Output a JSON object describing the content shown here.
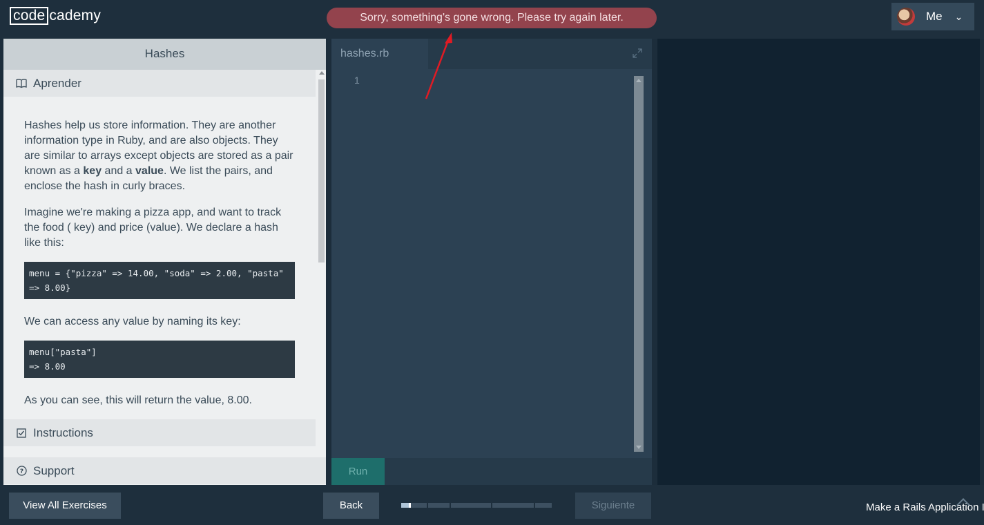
{
  "header": {
    "logo_boxed": "code",
    "logo_rest": "cademy",
    "error_message": "Sorry, something's gone wrong. Please try again later.",
    "user_label": "Me"
  },
  "lesson": {
    "title": "Hashes",
    "learn_label": "Aprender",
    "paragraph1_parts": [
      "Hashes help us store information. They are another information type in Ruby, and are also objects. They are similar to arrays except objects are stored as a pair known as a ",
      "key",
      " and a ",
      "value",
      ". We list the pairs, and enclose the hash in curly braces."
    ],
    "paragraph2": "Imagine we're making a pizza app, and want to track the food ( key) and price (value). We declare a hash like this:",
    "code1": "menu = {\"pizza\" => 14.00, \"soda\" => 2.00, \"pasta\" => 8.00}",
    "paragraph3": "We can access any value by naming its key:",
    "code2_line1": "menu[\"pasta\"]",
    "code2_line2": "=> 8.00",
    "paragraph4": "As you can see, this will return the value, 8.00.",
    "instructions_label": "Instructions",
    "support_label": "Support"
  },
  "editor": {
    "filename": "hashes.rb",
    "line_number": "1",
    "run_label": "Run"
  },
  "footer": {
    "view_all_label": "View All Exercises",
    "back_label": "Back",
    "next_label": "Siguiente",
    "project_label": "Make a Rails Application I",
    "progress_fraction": 0.15
  },
  "colors": {
    "error_banner": "#93434d",
    "annotation_arrow": "#e01b24",
    "run_button": "#1e6e6b"
  }
}
